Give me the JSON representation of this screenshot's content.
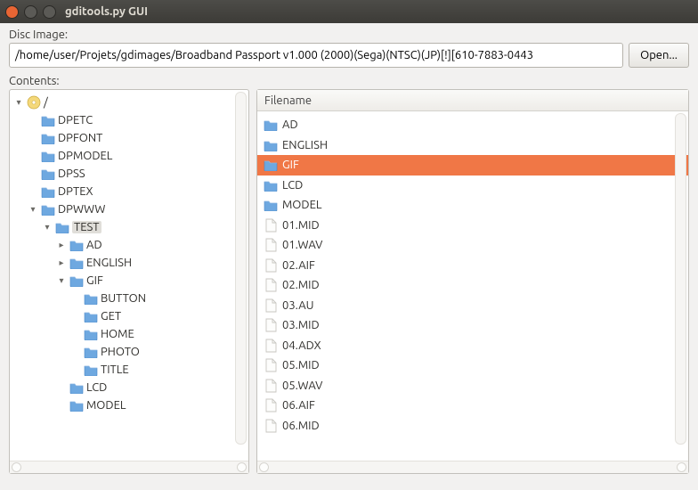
{
  "window": {
    "title": "gditools.py GUI"
  },
  "disc": {
    "label": "Disc Image:",
    "path": "/home/user/Projets/gdimages/Broadband Passport v1.000 (2000)(Sega)(NTSC)(JP)[!][610-7883-0443",
    "open_label": "Open..."
  },
  "contents": {
    "label": "Contents:"
  },
  "tree": [
    {
      "label": "/",
      "icon": "disc",
      "indent": 0,
      "expander": "down",
      "selected": false
    },
    {
      "label": "DPETC",
      "icon": "folder",
      "indent": 1,
      "expander": "",
      "selected": false
    },
    {
      "label": "DPFONT",
      "icon": "folder",
      "indent": 1,
      "expander": "",
      "selected": false
    },
    {
      "label": "DPMODEL",
      "icon": "folder",
      "indent": 1,
      "expander": "",
      "selected": false
    },
    {
      "label": "DPSS",
      "icon": "folder",
      "indent": 1,
      "expander": "",
      "selected": false
    },
    {
      "label": "DPTEX",
      "icon": "folder",
      "indent": 1,
      "expander": "",
      "selected": false
    },
    {
      "label": "DPWWW",
      "icon": "folder",
      "indent": 1,
      "expander": "down",
      "selected": false
    },
    {
      "label": "TEST",
      "icon": "folder",
      "indent": 2,
      "expander": "down",
      "selected": true
    },
    {
      "label": "AD",
      "icon": "folder",
      "indent": 3,
      "expander": "right",
      "selected": false
    },
    {
      "label": "ENGLISH",
      "icon": "folder",
      "indent": 3,
      "expander": "right",
      "selected": false
    },
    {
      "label": "GIF",
      "icon": "folder",
      "indent": 3,
      "expander": "down",
      "selected": false
    },
    {
      "label": "BUTTON",
      "icon": "folder",
      "indent": 4,
      "expander": "",
      "selected": false
    },
    {
      "label": "GET",
      "icon": "folder",
      "indent": 4,
      "expander": "",
      "selected": false
    },
    {
      "label": "HOME",
      "icon": "folder",
      "indent": 4,
      "expander": "",
      "selected": false
    },
    {
      "label": "PHOTO",
      "icon": "folder",
      "indent": 4,
      "expander": "",
      "selected": false
    },
    {
      "label": "TITLE",
      "icon": "folder",
      "indent": 4,
      "expander": "",
      "selected": false
    },
    {
      "label": "LCD",
      "icon": "folder",
      "indent": 3,
      "expander": "",
      "selected": false
    },
    {
      "label": "MODEL",
      "icon": "folder",
      "indent": 3,
      "expander": "",
      "selected": false
    }
  ],
  "list": {
    "header": "Filename",
    "items": [
      {
        "label": "AD",
        "icon": "folder",
        "selected": false
      },
      {
        "label": "ENGLISH",
        "icon": "folder",
        "selected": false
      },
      {
        "label": "GIF",
        "icon": "folder",
        "selected": true
      },
      {
        "label": "LCD",
        "icon": "folder",
        "selected": false
      },
      {
        "label": "MODEL",
        "icon": "folder",
        "selected": false
      },
      {
        "label": "01.MID",
        "icon": "file",
        "selected": false
      },
      {
        "label": "01.WAV",
        "icon": "file",
        "selected": false
      },
      {
        "label": "02.AIF",
        "icon": "file",
        "selected": false
      },
      {
        "label": "02.MID",
        "icon": "file",
        "selected": false
      },
      {
        "label": "03.AU",
        "icon": "file",
        "selected": false
      },
      {
        "label": "03.MID",
        "icon": "file",
        "selected": false
      },
      {
        "label": "04.ADX",
        "icon": "file",
        "selected": false
      },
      {
        "label": "05.MID",
        "icon": "file",
        "selected": false
      },
      {
        "label": "05.WAV",
        "icon": "file",
        "selected": false
      },
      {
        "label": "06.AIF",
        "icon": "file",
        "selected": false
      },
      {
        "label": "06.MID",
        "icon": "file",
        "selected": false
      }
    ]
  }
}
